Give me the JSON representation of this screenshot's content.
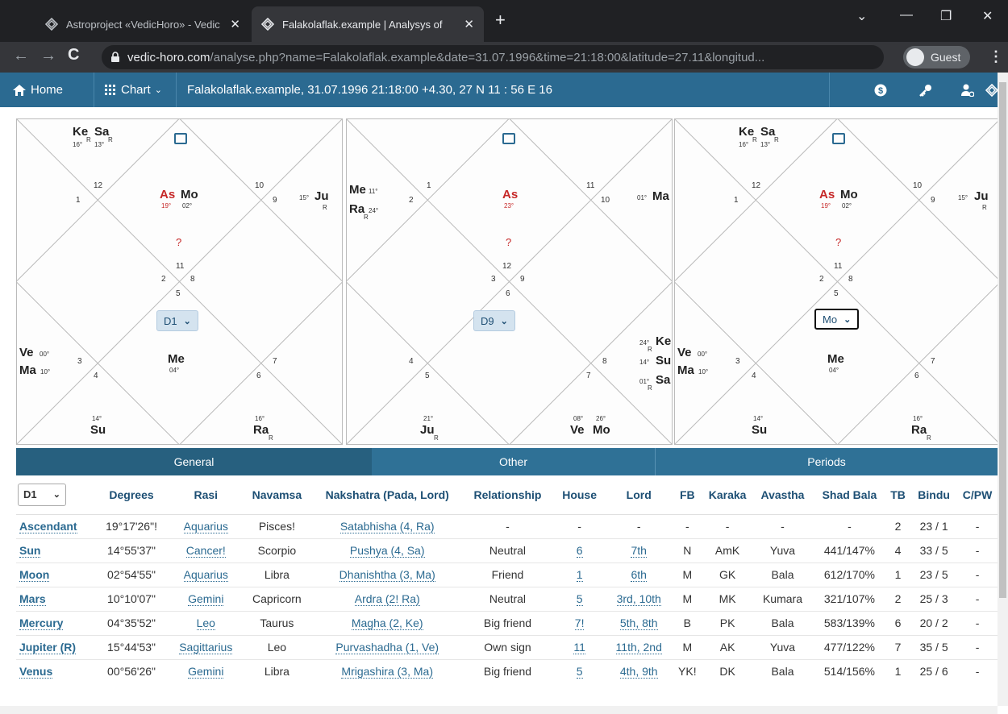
{
  "browser": {
    "tabs": [
      {
        "title": "Astroproject «VedicHoro» - Vedic",
        "active": false
      },
      {
        "title": "Falakolaflak.example | Analysys of",
        "active": true
      }
    ],
    "url_host": "vedic-horo.com",
    "url_path": "/analyse.php?name=Falakolaflak.example&date=31.07.1996&time=21:18:00&latitude=27.11&longitud...",
    "profile_label": "Guest"
  },
  "nav": {
    "home": "Home",
    "chart": "Chart",
    "title": "Falakolaflak.example, 31.07.1996 21:18:00 +4.30, 27 N 11 : 56 E 16"
  },
  "charts": [
    {
      "select": "D1",
      "houses": [
        "1",
        "2",
        "3",
        "4",
        "5",
        "6",
        "7",
        "8",
        "9",
        "10",
        "11",
        "12"
      ],
      "planets": {
        "as": {
          "name": "As",
          "deg": "19°"
        },
        "mo": {
          "name": "Mo",
          "deg": "02°"
        },
        "ju": {
          "name": "Ju",
          "deg": "15°",
          "sub": "R"
        },
        "ke": {
          "name": "Ke",
          "deg": "16°",
          "sub": "R"
        },
        "sa": {
          "name": "Sa",
          "deg": "13°",
          "sub": "R"
        },
        "ve": {
          "name": "Ve",
          "deg": "00°"
        },
        "ma": {
          "name": "Ma",
          "deg": "10°"
        },
        "me": {
          "name": "Me",
          "deg": "04°"
        },
        "su": {
          "name": "Su",
          "deg": "14°"
        },
        "ra": {
          "name": "Ra",
          "deg": "16°",
          "sub": "R"
        }
      }
    },
    {
      "select": "D9",
      "houses": [
        "1",
        "2",
        "3",
        "4",
        "5",
        "6",
        "7",
        "8",
        "9",
        "10",
        "11",
        "12"
      ],
      "planets": {
        "as": {
          "name": "As",
          "deg": "23°"
        },
        "me": {
          "name": "Me",
          "deg": "11°"
        },
        "ra": {
          "name": "Ra",
          "deg": "24°",
          "sub": "R"
        },
        "ma": {
          "name": "Ma",
          "deg": "01°"
        },
        "ke": {
          "name": "Ke",
          "deg": "24°",
          "sub": "R"
        },
        "su": {
          "name": "Su",
          "deg": "14°"
        },
        "sa": {
          "name": "Sa",
          "deg": "01°",
          "sub": "R"
        },
        "ju": {
          "name": "Ju",
          "deg": "21°",
          "sub": "R"
        },
        "ve": {
          "name": "Ve",
          "deg": "08°"
        },
        "mo": {
          "name": "Mo",
          "deg": "26°"
        }
      }
    },
    {
      "select": "Mo",
      "houses": [
        "1",
        "2",
        "3",
        "4",
        "5",
        "6",
        "7",
        "8",
        "9",
        "10",
        "11",
        "12"
      ],
      "planets": {
        "as": {
          "name": "As",
          "deg": "19°"
        },
        "mo": {
          "name": "Mo",
          "deg": "02°"
        },
        "ju": {
          "name": "Ju",
          "deg": "15°",
          "sub": "R"
        },
        "ke": {
          "name": "Ke",
          "deg": "16°",
          "sub": "R"
        },
        "sa": {
          "name": "Sa",
          "deg": "13°",
          "sub": "R"
        },
        "ve": {
          "name": "Ve",
          "deg": "00°"
        },
        "ma": {
          "name": "Ma",
          "deg": "10°"
        },
        "me": {
          "name": "Me",
          "deg": "04°"
        },
        "su": {
          "name": "Su",
          "deg": "14°"
        },
        "ra": {
          "name": "Ra",
          "deg": "16°",
          "sub": "R"
        }
      }
    }
  ],
  "qmark": "?",
  "section_tabs": [
    "General",
    "Other",
    "Periods"
  ],
  "table": {
    "select": "D1",
    "headers": [
      "Degrees",
      "Rasi",
      "Navamsa",
      "Nakshatra (Pada, Lord)",
      "Relationship",
      "House",
      "Lord",
      "FB",
      "Karaka",
      "Avastha",
      "Shad Bala",
      "TB",
      "Bindu",
      "C/PW"
    ],
    "rows": [
      [
        "Ascendant",
        "19°17'26\"!",
        "Aquarius",
        "Pisces!",
        "Satabhisha (4, Ra)",
        "-",
        "-",
        "-",
        "-",
        "-",
        "-",
        "-",
        "2",
        "23 / 1",
        "-"
      ],
      [
        "Sun",
        "14°55'37\"",
        "Cancer!",
        "Scorpio",
        "Pushya (4, Sa)",
        "Neutral",
        "6",
        "7th",
        "N",
        "AmK",
        "Yuva",
        "441/147%",
        "4",
        "33 / 5",
        "-"
      ],
      [
        "Moon",
        "02°54'55\"",
        "Aquarius",
        "Libra",
        "Dhanishtha (3, Ma)",
        "Friend",
        "1",
        "6th",
        "M",
        "GK",
        "Bala",
        "612/170%",
        "1",
        "23 / 5",
        "-"
      ],
      [
        "Mars",
        "10°10'07\"",
        "Gemini",
        "Capricorn",
        "Ardra (2! Ra)",
        "Neutral",
        "5",
        "3rd, 10th",
        "M",
        "MK",
        "Kumara",
        "321/107%",
        "2",
        "25 / 3",
        "-"
      ],
      [
        "Mercury",
        "04°35'52\"",
        "Leo",
        "Taurus",
        "Magha (2, Ke)",
        "Big friend",
        "7!",
        "5th, 8th",
        "B",
        "PK",
        "Bala",
        "583/139%",
        "6",
        "20 / 2",
        "-"
      ],
      [
        "Jupiter (R)",
        "15°44'53\"",
        "Sagittarius",
        "Leo",
        "Purvashadha (1, Ve)",
        "Own sign",
        "11",
        "11th, 2nd",
        "M",
        "AK",
        "Yuva",
        "477/122%",
        "7",
        "35 / 5",
        "-"
      ],
      [
        "Venus",
        "00°56'26\"",
        "Gemini",
        "Libra",
        "Mrigashira (3, Ma)",
        "Big friend",
        "5",
        "4th, 9th",
        "YK!",
        "DK",
        "Bala",
        "514/156%",
        "1",
        "25 / 6",
        "-"
      ]
    ]
  }
}
